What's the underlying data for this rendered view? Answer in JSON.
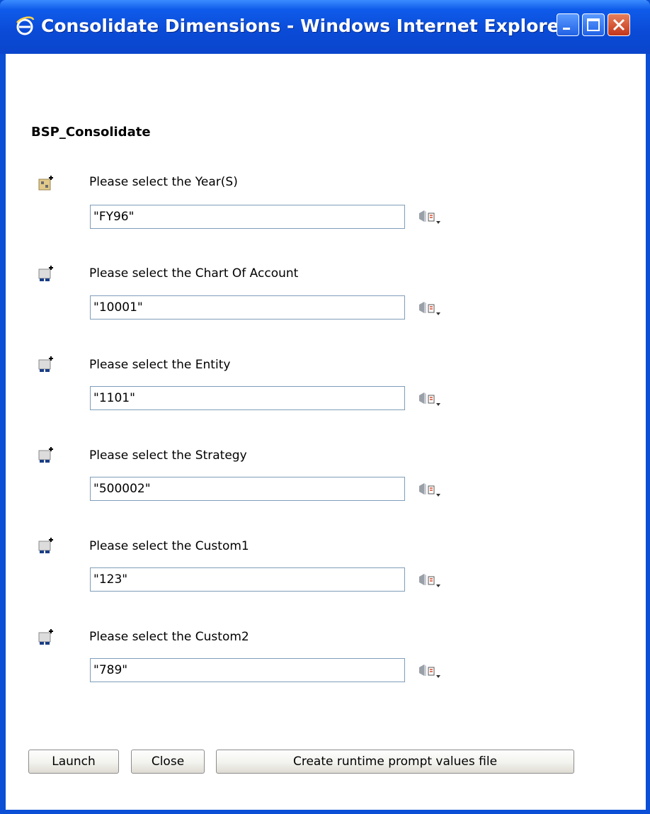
{
  "window": {
    "title": "Consolidate Dimensions - Windows Internet Explorer"
  },
  "form": {
    "heading": "BSP_Consolidate",
    "fields": [
      {
        "label": "Please select the Year(S)",
        "value": "\"FY96\""
      },
      {
        "label": "Please select the Chart Of Account",
        "value": "\"10001\""
      },
      {
        "label": "Please select the Entity",
        "value": "\"1101\""
      },
      {
        "label": "Please select the Strategy",
        "value": "\"500002\""
      },
      {
        "label": "Please select the Custom1",
        "value": "\"123\""
      },
      {
        "label": "Please select the Custom2",
        "value": "\"789\""
      }
    ]
  },
  "buttons": {
    "launch": "Launch",
    "close": "Close",
    "create": "Create runtime prompt values file"
  },
  "colors": {
    "titlebar": "#0a4ad6",
    "input_border": "#7f9db9"
  }
}
